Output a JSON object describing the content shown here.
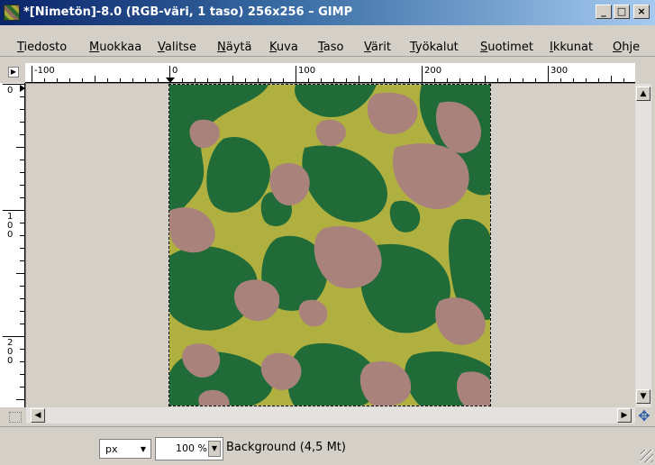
{
  "window": {
    "title": "*[Nimetön]-8.0 (RGB-väri, 1 taso) 256x256 – GIMP",
    "minimize": "_",
    "maximize": "□",
    "close": "×"
  },
  "menu": [
    "Tiedosto",
    "Muokkaa",
    "Valitse",
    "Näytä",
    "Kuva",
    "Taso",
    "Värit",
    "Työkalut",
    "Suotimet",
    "Ikkunat",
    "Ohje"
  ],
  "ruler": {
    "h_labels": [
      "-100",
      "0",
      "100",
      "200",
      "300"
    ],
    "v_labels": [
      "0",
      "100",
      "200"
    ]
  },
  "statusbar": {
    "unit": "px",
    "zoom": "100 %",
    "layer_info": "Background (4,5 Mt)"
  },
  "image": {
    "colors": {
      "green": "#216b38",
      "olive": "#b0b040",
      "rose": "#a9837b"
    }
  }
}
